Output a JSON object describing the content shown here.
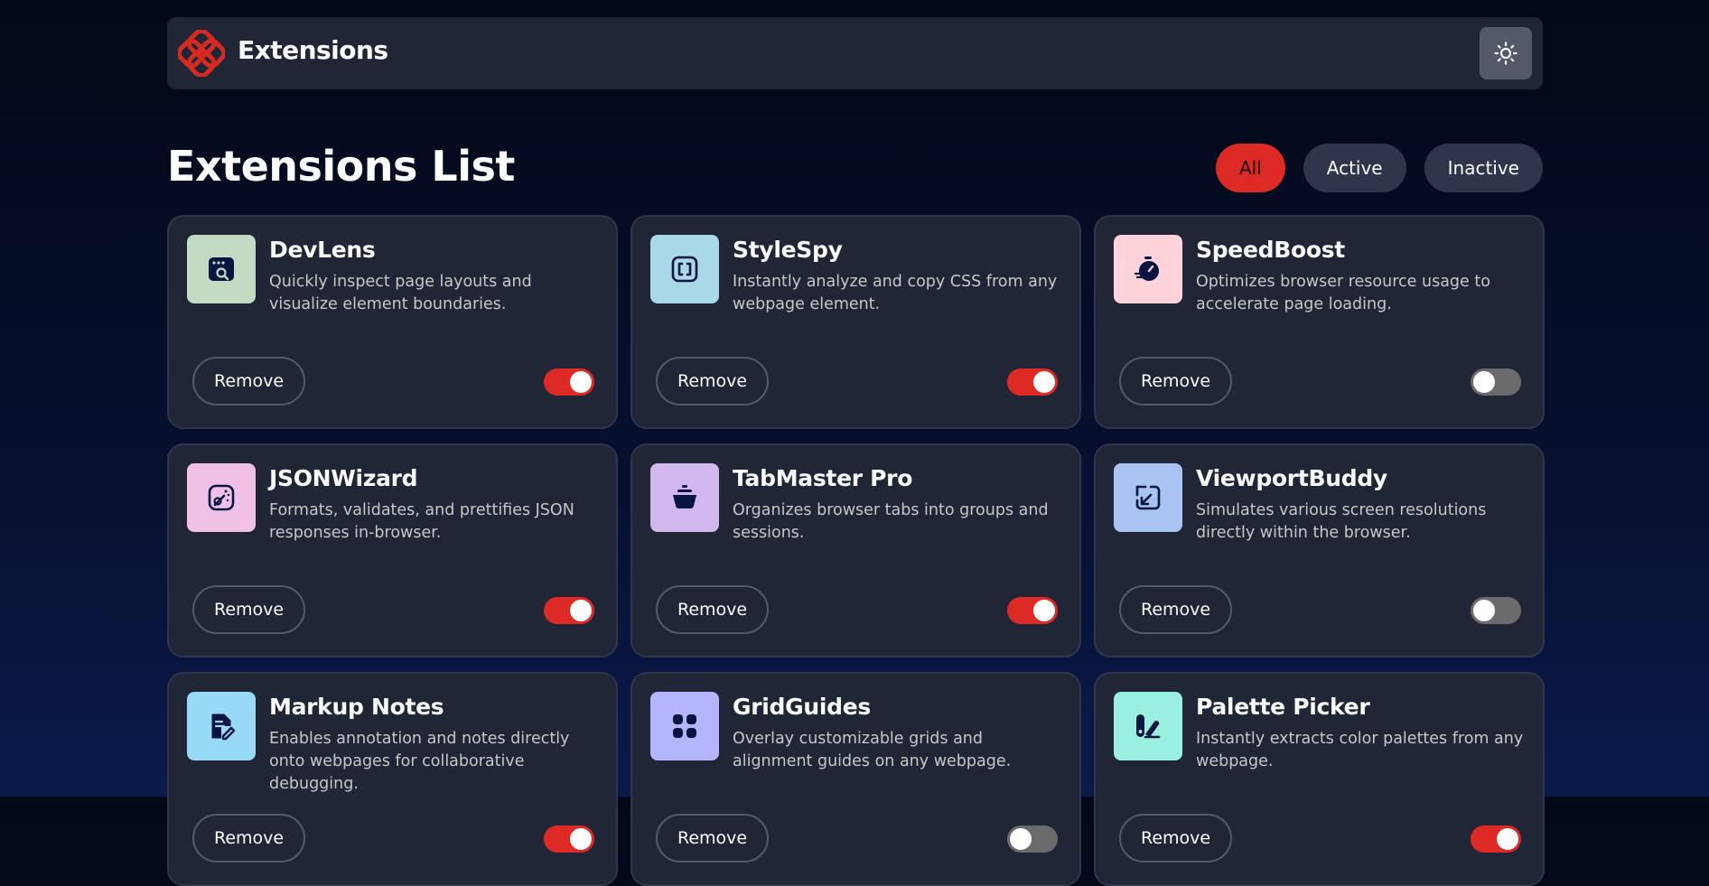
{
  "header": {
    "logo_text": "Extensions",
    "theme_toggle_icon": "sun-icon"
  },
  "page": {
    "title": "Extensions List",
    "filters": [
      {
        "label": "All",
        "active": true
      },
      {
        "label": "Active",
        "active": false
      },
      {
        "label": "Inactive",
        "active": false
      }
    ]
  },
  "colors": {
    "accent": "#de2a24",
    "card_bg": "#212636",
    "toggle_off": "#6b6b6b"
  },
  "extensions": [
    {
      "name": "DevLens",
      "description": "Quickly inspect page layouts and visualize element boundaries.",
      "enabled": true,
      "icon": "devlens-icon",
      "icon_bg": "#c2dcc3",
      "remove_label": "Remove"
    },
    {
      "name": "StyleSpy",
      "description": "Instantly analyze and copy CSS from any webpage element.",
      "enabled": true,
      "icon": "stylespy-icon",
      "icon_bg": "#a9d8e6",
      "remove_label": "Remove"
    },
    {
      "name": "SpeedBoost",
      "description": "Optimizes browser resource usage to accelerate page loading.",
      "enabled": false,
      "icon": "speedboost-icon",
      "icon_bg": "#ffd3d9",
      "remove_label": "Remove"
    },
    {
      "name": "JSONWizard",
      "description": "Formats, validates, and prettifies JSON responses in-browser.",
      "enabled": true,
      "icon": "jsonwizard-icon",
      "icon_bg": "#f0c0e6",
      "remove_label": "Remove"
    },
    {
      "name": "TabMaster Pro",
      "description": "Organizes browser tabs into groups and sessions.",
      "enabled": true,
      "icon": "tabmaster-icon",
      "icon_bg": "#d2b8ef",
      "remove_label": "Remove"
    },
    {
      "name": "ViewportBuddy",
      "description": "Simulates various screen resolutions directly within the browser.",
      "enabled": false,
      "icon": "viewportbuddy-icon",
      "icon_bg": "#a9c4f2",
      "remove_label": "Remove"
    },
    {
      "name": "Markup Notes",
      "description": "Enables annotation and notes directly onto webpages for collaborative debugging.",
      "enabled": true,
      "icon": "markupnotes-icon",
      "icon_bg": "#98d9f7",
      "remove_label": "Remove"
    },
    {
      "name": "GridGuides",
      "description": "Overlay customizable grids and alignment guides on any webpage.",
      "enabled": false,
      "icon": "gridguides-icon",
      "icon_bg": "#b5b4ff",
      "remove_label": "Remove"
    },
    {
      "name": "Palette Picker",
      "description": "Instantly extracts color palettes from any webpage.",
      "enabled": true,
      "icon": "palettepicker-icon",
      "icon_bg": "#9af0e0",
      "remove_label": "Remove"
    }
  ]
}
